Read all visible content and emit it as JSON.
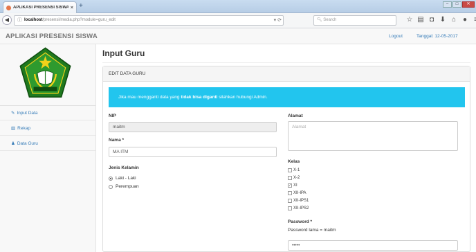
{
  "browser": {
    "tab_title": "APLIKASI PRESENSI SISWA",
    "tab_close": "×",
    "new_tab": "+",
    "url_host": "localhost",
    "url_path": "/presensi/media.php?module=guru_edit",
    "search_placeholder": "Search",
    "icons": [
      "star-icon",
      "bookmark-list-icon",
      "pocket-icon",
      "download-icon",
      "home-icon",
      "chat-icon",
      "menu-icon"
    ]
  },
  "header": {
    "brand": "APLIKASI PRESENSI SISWA",
    "logout": "Logout",
    "tanggal": "Tanggal: 12-05-2017"
  },
  "sidebar": {
    "items": [
      {
        "label": "Input Data",
        "icon": "edit-icon"
      },
      {
        "label": "Rekap",
        "icon": "bar-chart-icon"
      },
      {
        "label": "Data Guru",
        "icon": "user-icon"
      }
    ]
  },
  "main": {
    "page_title": "Input Guru",
    "panel_title": "EDIT DATA GURU",
    "alert": {
      "prefix": "Jika mau mengganti data yang ",
      "bold": "tidak bisa diganti",
      "suffix": " silahkan hubungi Admin."
    },
    "form": {
      "nip_label": "NIP",
      "nip_value": "maitm",
      "nama_label": "Nama",
      "nama_value": "MA ITM",
      "required_mark": "*",
      "jk_label": "Jenis Kelamin",
      "jk_options": [
        {
          "label": "Laki - Laki",
          "checked": true
        },
        {
          "label": "Perempuan",
          "checked": false
        }
      ],
      "alamat_label": "Alamat",
      "alamat_placeholder": "Alamat",
      "kelas_label": "Kelas",
      "kelas_options": [
        {
          "label": "X-1",
          "checked": false
        },
        {
          "label": "X-2",
          "checked": false
        },
        {
          "label": "XI",
          "checked": true
        },
        {
          "label": "XII-IPA",
          "checked": false
        },
        {
          "label": "XII-IPS1",
          "checked": false
        },
        {
          "label": "XII-IPS2",
          "checked": false
        }
      ],
      "password_label": "Password",
      "password_note": "Password lama = maitm",
      "password_value": "•••••"
    }
  }
}
